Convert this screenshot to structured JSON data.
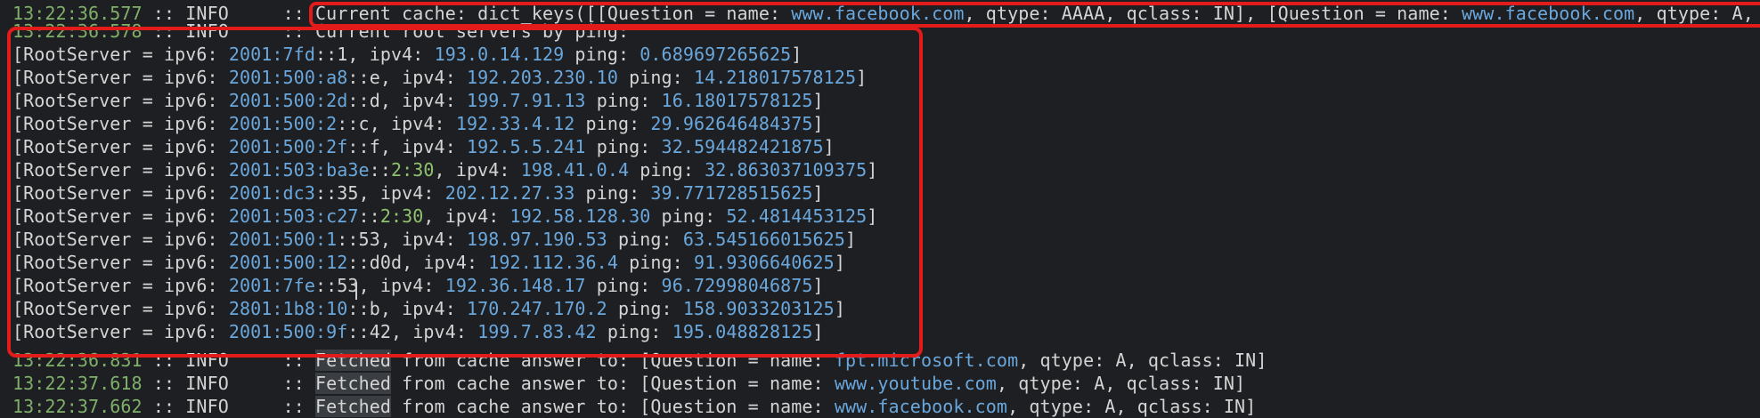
{
  "header": {
    "timestamp": "13:22:36.577",
    "level": "INFO",
    "sep": "::",
    "msg_prefix": "Current cache: dict_keys([[Question = name: ",
    "host1": "www.facebook.com",
    "mid1": ", qtype: AAAA, qclass: IN], [Question = name: ",
    "host2": "www.facebook.com",
    "tail": ", qtype: A, q"
  },
  "root_header": {
    "timestamp": "13:22:36.578",
    "level": "INFO",
    "sep": "::",
    "msg": "Current root servers by ping:"
  },
  "servers": [
    {
      "ip6_a": "2001:7fd",
      "ip6_b": "1",
      "ip4": "193.0.14.129",
      "ping": "0.689697265625"
    },
    {
      "ip6_a": "2001:500:a8",
      "ip6_b": "e",
      "ip4": "192.203.230.10",
      "ping": "14.218017578125"
    },
    {
      "ip6_a": "2001:500:2d",
      "ip6_b": "d",
      "ip4": "199.7.91.13",
      "ping": "16.18017578125"
    },
    {
      "ip6_a": "2001:500:2",
      "ip6_b": "c",
      "ip4": "192.33.4.12",
      "ping": "29.962646484375"
    },
    {
      "ip6_a": "2001:500:2f",
      "ip6_b": "f",
      "ip4": "192.5.5.241",
      "ping": "32.594482421875"
    },
    {
      "ip6_a": "2001:503:ba3e",
      "ip6_b": "2:30",
      "ip4": "198.41.0.4",
      "ping": "32.863037109375"
    },
    {
      "ip6_a": "2001:dc3",
      "ip6_b": "35",
      "ip4": "202.12.27.33",
      "ping": "39.771728515625"
    },
    {
      "ip6_a": "2001:503:c27",
      "ip6_b": "2:30",
      "ip4": "192.58.128.30",
      "ping": "52.4814453125"
    },
    {
      "ip6_a": "2001:500:1",
      "ip6_b": "53",
      "ip4": "198.97.190.53",
      "ping": "63.545166015625"
    },
    {
      "ip6_a": "2001:500:12",
      "ip6_b": "d0d",
      "ip4": "192.112.36.4",
      "ping": "91.9306640625"
    },
    {
      "ip6_a": "2001:7fe",
      "ip6_b": "53",
      "ip4": "192.36.148.17",
      "ping": "96.72998046875"
    },
    {
      "ip6_a": "2801:1b8:10",
      "ip6_b": "b",
      "ip4": "170.247.170.2",
      "ping": "158.9033203125"
    },
    {
      "ip6_a": "2001:500:9f",
      "ip6_b": "42",
      "ip4": "199.7.83.42",
      "ping": "195.048828125"
    }
  ],
  "server_text": {
    "prefix": "[RootServer = ipv6: ",
    "dc": "::",
    "ipv4": ", ipv4: ",
    "ping": " ping: ",
    "close": "]"
  },
  "footer": [
    {
      "timestamp": "13:22:36.831",
      "level": "INFO",
      "sep": "::",
      "fetched": "Fetched",
      "msg": " from cache answer to: [Question = name: ",
      "host": "fpt.microsoft.com",
      "tail": ", qtype: A, qclass: IN]"
    },
    {
      "timestamp": "13:22:37.618",
      "level": "INFO",
      "sep": "::",
      "fetched": "Fetched",
      "msg": " from cache answer to: [Question = name: ",
      "host": "www.youtube.com",
      "tail": ", qtype: A, qclass: IN]"
    },
    {
      "timestamp": "13:22:37.662",
      "level": "INFO",
      "sep": "::",
      "fetched": "Fetched",
      "msg": " from cache answer to: [Question = name: ",
      "host": "www.facebook.com",
      "tail": ", qtype: A, qclass: IN]"
    }
  ],
  "colors": {
    "background": "#1e1f22",
    "timestamp": "#7fb06a",
    "value": "#6aa7dc",
    "highlight_box": "#e21b1b"
  }
}
